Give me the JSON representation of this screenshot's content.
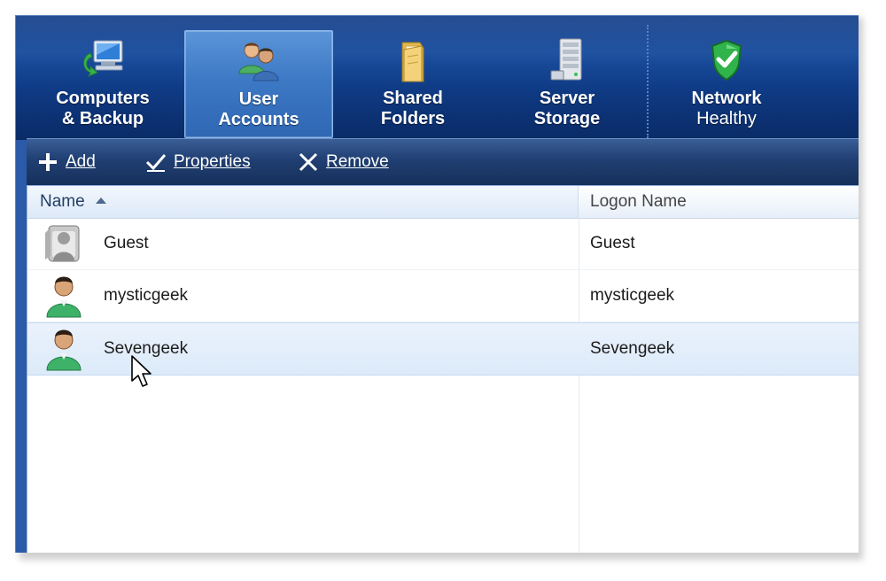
{
  "nav": {
    "tabs": [
      {
        "line1": "Computers",
        "line2": "& Backup",
        "icon": "computer-backup-icon",
        "active": false
      },
      {
        "line1": "User",
        "line2": "Accounts",
        "icon": "users-icon",
        "active": true
      },
      {
        "line1": "Shared",
        "line2": "Folders",
        "icon": "folder-icon",
        "active": false
      },
      {
        "line1": "Server",
        "line2": "Storage",
        "icon": "server-storage-icon",
        "active": false
      },
      {
        "line1": "Network",
        "line2": "Healthy",
        "icon": "shield-check-icon",
        "active": false
      }
    ]
  },
  "toolbar": {
    "add_label": "Add",
    "properties_label": "Properties",
    "remove_label": "Remove"
  },
  "table": {
    "columns": [
      "Name",
      "Logon Name"
    ],
    "sorted_column": "Name",
    "rows": [
      {
        "name": "Guest",
        "logon": "Guest",
        "avatar": "guest-user-icon"
      },
      {
        "name": "mysticgeek",
        "logon": "mysticgeek",
        "avatar": "user-icon"
      },
      {
        "name": "Sevengeek",
        "logon": "Sevengeek",
        "avatar": "user-icon",
        "selected": true
      }
    ]
  },
  "colors": {
    "nav_bg": "#0d3a86",
    "active_tab": "#3d79c5",
    "toolbar_bg": "#203f72",
    "selected_row": "#dceaf9",
    "healthy_green": "#2fb34a"
  }
}
